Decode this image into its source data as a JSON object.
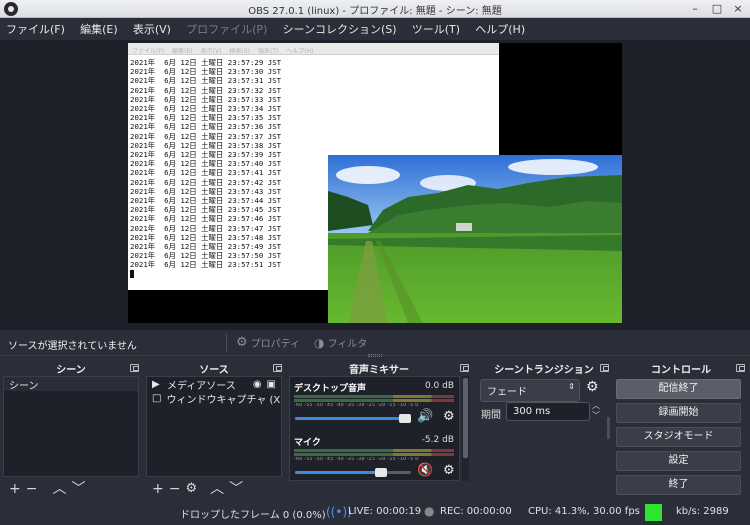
{
  "window": {
    "title": "OBS 27.0.1 (linux) - プロファイル: 無題 - シーン: 無題",
    "min": "–",
    "max": "□",
    "close": "×"
  },
  "menu": [
    {
      "label": "ファイル(F)",
      "disabled": false
    },
    {
      "label": "編集(E)",
      "disabled": false
    },
    {
      "label": "表示(V)",
      "disabled": false
    },
    {
      "label": "プロファイル(P)",
      "disabled": true
    },
    {
      "label": "シーンコレクション(S)",
      "disabled": false
    },
    {
      "label": "ツール(T)",
      "disabled": false
    },
    {
      "label": "ヘルプ(H)",
      "disabled": false
    }
  ],
  "preview": {
    "terminal_menu": [
      "ファイル(F)",
      "編集(E)",
      "表示(V)",
      "検索(S)",
      "端末(T)",
      "ヘルプ(H)"
    ],
    "terminal_lines": [
      "2021年  6月 12日 土曜日 23:57:29 JST",
      "2021年  6月 12日 土曜日 23:57:30 JST",
      "2021年  6月 12日 土曜日 23:57:31 JST",
      "2021年  6月 12日 土曜日 23:57:32 JST",
      "2021年  6月 12日 土曜日 23:57:33 JST",
      "2021年  6月 12日 土曜日 23:57:34 JST",
      "2021年  6月 12日 土曜日 23:57:35 JST",
      "2021年  6月 12日 土曜日 23:57:36 JST",
      "2021年  6月 12日 土曜日 23:57:37 JST",
      "2021年  6月 12日 土曜日 23:57:38 JST",
      "2021年  6月 12日 土曜日 23:57:39 JST",
      "2021年  6月 12日 土曜日 23:57:40 JST",
      "2021年  6月 12日 土曜日 23:57:41 JST",
      "2021年  6月 12日 土曜日 23:57:42 JST",
      "2021年  6月 12日 土曜日 23:57:43 JST",
      "2021年  6月 12日 土曜日 23:57:44 JST",
      "2021年  6月 12日 土曜日 23:57:45 JST",
      "2021年  6月 12日 土曜日 23:57:46 JST",
      "2021年  6月 12日 土曜日 23:57:47 JST",
      "2021年  6月 12日 土曜日 23:57:48 JST",
      "2021年  6月 12日 土曜日 23:57:49 JST",
      "2021年  6月 12日 土曜日 23:57:50 JST",
      "2021年  6月 12日 土曜日 23:57:51 JST"
    ]
  },
  "source_bar": {
    "no_source": "ソースが選択されていません",
    "properties": "プロパティ",
    "filters": "フィルタ"
  },
  "scenes": {
    "title": "シーン",
    "items": [
      "シーン"
    ]
  },
  "sources": {
    "title": "ソース",
    "items": [
      {
        "label": "メディアソース",
        "icon": "play-icon",
        "glyph": "▶"
      },
      {
        "label": "ウィンドウキャプチャ (X",
        "icon": "window-icon",
        "glyph": "□"
      }
    ]
  },
  "mixer": {
    "title": "音声ミキサー",
    "ticks": "-60 -55 -50 -45 -40 -35 -30 -25 -20 -15 -10 -5 0",
    "channels": [
      {
        "name": "デスクトップ音声",
        "db": "0.0 dB",
        "level": 0.95,
        "muted": false,
        "meter": 0
      },
      {
        "name": "マイク",
        "db": "-5.2 dB",
        "level": 0.74,
        "muted": true,
        "meter": 0.02
      }
    ]
  },
  "transitions": {
    "title": "シーントランジション",
    "selected": "フェード",
    "duration_label": "期間",
    "duration": "300 ms"
  },
  "controls": {
    "title": "コントロール",
    "buttons": [
      "配信終了",
      "録画開始",
      "スタジオモード",
      "設定",
      "終了"
    ]
  },
  "status": {
    "dropped": "ドロップしたフレーム 0 (0.0%)",
    "live": "LIVE: 00:00:19",
    "rec": "REC: 00:00:00",
    "cpu": "CPU: 41.3%, 30.00 fps",
    "kbs": "kb/s: 2989",
    "live_color": "#2ee62e"
  },
  "accent": "#3d8be0"
}
